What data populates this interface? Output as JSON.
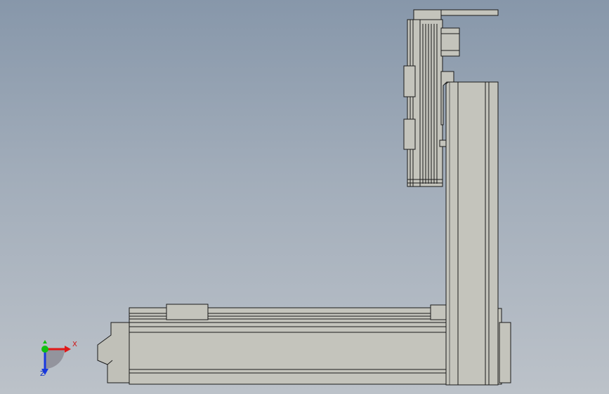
{
  "viewport": {
    "background_top": "#8797aa",
    "background_bottom": "#bcc2c9"
  },
  "model": {
    "part_fill": "#c4c4bc",
    "part_shade": "#b8b8b0",
    "edge_color": "#1a1a1a"
  },
  "triad": {
    "x_label": "X",
    "z_label": "Z",
    "x_color": "#e01818",
    "y_color": "#10c010",
    "z_color": "#1838e0"
  }
}
